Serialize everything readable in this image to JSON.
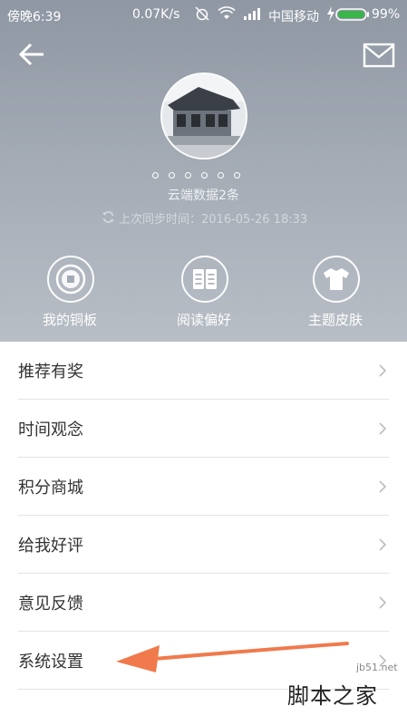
{
  "status_bar": {
    "time": "傍晚6:39",
    "network_speed": "0.07K/s",
    "carrier": "中国移动",
    "battery": "99%",
    "battery_color": "#39b54a"
  },
  "header": {
    "bg_colors": [
      "#8f97a3",
      "#b8bec6"
    ],
    "back_icon": "back-arrow-icon",
    "mail_icon": "mail-icon",
    "cloud_data_text": "云端数据2条",
    "sync_text": "上次同步时间：2016-05-26 18:33",
    "dots_count": 6
  },
  "quick_actions": [
    {
      "label": "我的铜板",
      "icon": "coin-icon"
    },
    {
      "label": "阅读偏好",
      "icon": "book-icon"
    },
    {
      "label": "主题皮肤",
      "icon": "tshirt-icon"
    }
  ],
  "menu": [
    {
      "label": "推荐有奖"
    },
    {
      "label": "时间观念"
    },
    {
      "label": "积分商城"
    },
    {
      "label": "给我好评"
    },
    {
      "label": "意见反馈"
    },
    {
      "label": "系统设置"
    }
  ],
  "annotation": {
    "arrow_color": "#f07a4c"
  },
  "watermark": {
    "url": "jb51.net",
    "text": "脚本之家"
  }
}
